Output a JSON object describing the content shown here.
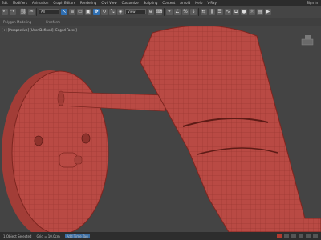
{
  "menu": {
    "items": [
      "Edit",
      "Modifiers",
      "Animation",
      "Graph Editors",
      "Rendering",
      "Civil View",
      "Customize",
      "Scripting",
      "Content",
      "Arnold",
      "Help",
      "V-Ray"
    ],
    "sign_in": "Sign In"
  },
  "toolbar": {
    "selection_filter": "All",
    "view_dropdown": "View"
  },
  "ribbon": {
    "labels": [
      "Polygon Modeling",
      "Freeform"
    ]
  },
  "viewport": {
    "label": "[+] [Perspective] [User Defined] [Edged Faces]",
    "object_color": "#b94a44",
    "wire_color": "#7d2620"
  },
  "status": {
    "left": "1 Object Selected",
    "grid": "Grid = 10.0cm",
    "tag": "Add Time Tag"
  }
}
